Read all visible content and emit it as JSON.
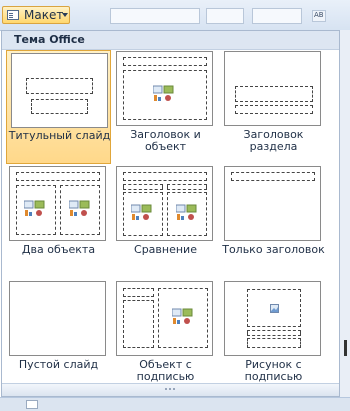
{
  "toolbar": {
    "layout_button_label": "Макет",
    "layout_icon": "layout-icon",
    "dropdown_icon": "chevron-down-icon",
    "mini_button_text": "AB"
  },
  "gallery": {
    "header": "Тема Office",
    "selected_index": 0,
    "layouts": [
      {
        "label": "Титульный слайд",
        "thumbnail": "title-slide-layout-icon"
      },
      {
        "label": "Заголовок и объект",
        "thumbnail": "title-and-content-layout-icon"
      },
      {
        "label": "Заголовок раздела",
        "thumbnail": "section-header-layout-icon"
      },
      {
        "label": "Два объекта",
        "thumbnail": "two-content-layout-icon"
      },
      {
        "label": "Сравнение",
        "thumbnail": "comparison-layout-icon"
      },
      {
        "label": "Только заголовок",
        "thumbnail": "title-only-layout-icon"
      },
      {
        "label": "Пустой слайд",
        "thumbnail": "blank-layout-icon"
      },
      {
        "label": "Объект с подписью",
        "thumbnail": "content-with-caption-layout-icon"
      },
      {
        "label": "Рисунок с подписью",
        "thumbnail": "picture-with-caption-layout-icon"
      }
    ]
  },
  "colors": {
    "accent_selected": "#ffd88a",
    "selected_border": "#e0a63a",
    "header_bg": "#dde6f2",
    "text": "#1f2f46"
  }
}
